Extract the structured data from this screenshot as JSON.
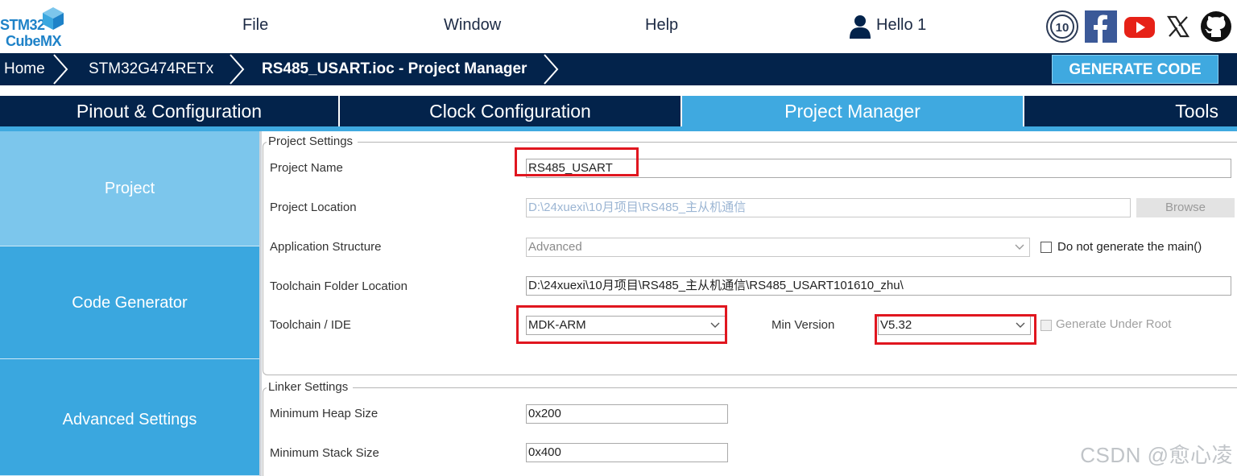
{
  "logo": {
    "line1": "STM32",
    "line2": "CubeMX"
  },
  "menu": {
    "file": "File",
    "window": "Window",
    "help": "Help",
    "user": "Hello 1"
  },
  "social_icons": [
    "st-community-icon",
    "facebook-icon",
    "youtube-icon",
    "x-icon",
    "github-icon"
  ],
  "social_badge": "10",
  "breadcrumb": [
    "Home",
    "STM32G474RETx",
    "RS485_USART.ioc - Project Manager"
  ],
  "generate_button": "GENERATE CODE",
  "tabs": [
    "Pinout & Configuration",
    "Clock Configuration",
    "Project Manager",
    "Tools"
  ],
  "active_tab": "Project Manager",
  "sidebar": {
    "items": [
      "Project",
      "Code Generator",
      "Advanced Settings"
    ],
    "active": "Project"
  },
  "project_settings": {
    "legend": "Project Settings",
    "project_name_label": "Project Name",
    "project_name": "RS485_USART",
    "project_location_label": "Project Location",
    "project_location": "D:\\24xuexi\\10月项目\\RS485_主从机通信",
    "browse": "Browse",
    "app_structure_label": "Application Structure",
    "app_structure": "Advanced",
    "no_main_label": "Do not generate the main()",
    "toolchain_folder_label": "Toolchain Folder Location",
    "toolchain_folder": "D:\\24xuexi\\10月项目\\RS485_主从机通信\\RS485_USART101610_zhu\\",
    "toolchain_label": "Toolchain / IDE",
    "toolchain": "MDK-ARM",
    "min_version_label": "Min Version",
    "min_version": "V5.32",
    "generate_under_root": "Generate Under Root"
  },
  "linker_settings": {
    "legend": "Linker Settings",
    "heap_label": "Minimum Heap Size",
    "heap": "0x200",
    "stack_label": "Minimum Stack Size",
    "stack": "0x400"
  },
  "watermark": "CSDN @愈心凌",
  "colors": {
    "navy": "#03234b",
    "accent": "#3fa9e0",
    "highlight": "#e0161f",
    "sidebar_active": "#7cc6ec"
  }
}
